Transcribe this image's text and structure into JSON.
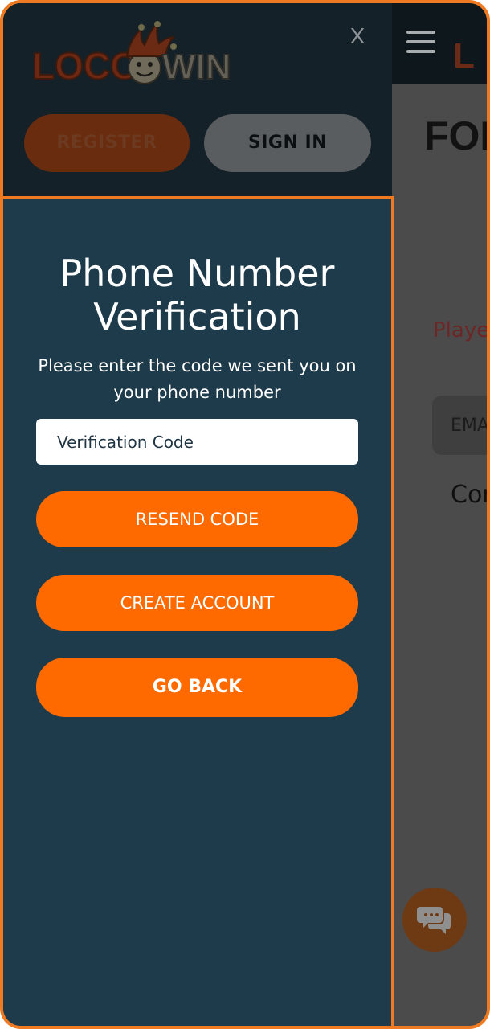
{
  "background_page": {
    "logo_fragment": "L",
    "title_fragment": "FOR",
    "player_fragment": "Player",
    "email_placeholder_fragment": "EMA",
    "continue_fragment": "Con"
  },
  "drawer": {
    "close_label": "X",
    "register_label": "REGISTER",
    "signin_label": "SIGN IN"
  },
  "verification": {
    "title": "Phone Number Verification",
    "subtitle": "Please enter the code we sent you on your phone number",
    "code_placeholder": "Verification Code",
    "resend_label": "RESEND CODE",
    "create_label": "CREATE ACCOUNT",
    "back_label": "GO BACK"
  },
  "colors": {
    "accent": "#ff6a00",
    "frame_border": "#f07a22",
    "panel_bg": "#1e3b4b",
    "header_bg": "#152129"
  },
  "icons": {
    "menu": "hamburger-icon",
    "chat": "chat-bubbles-icon",
    "close": "close-icon"
  }
}
